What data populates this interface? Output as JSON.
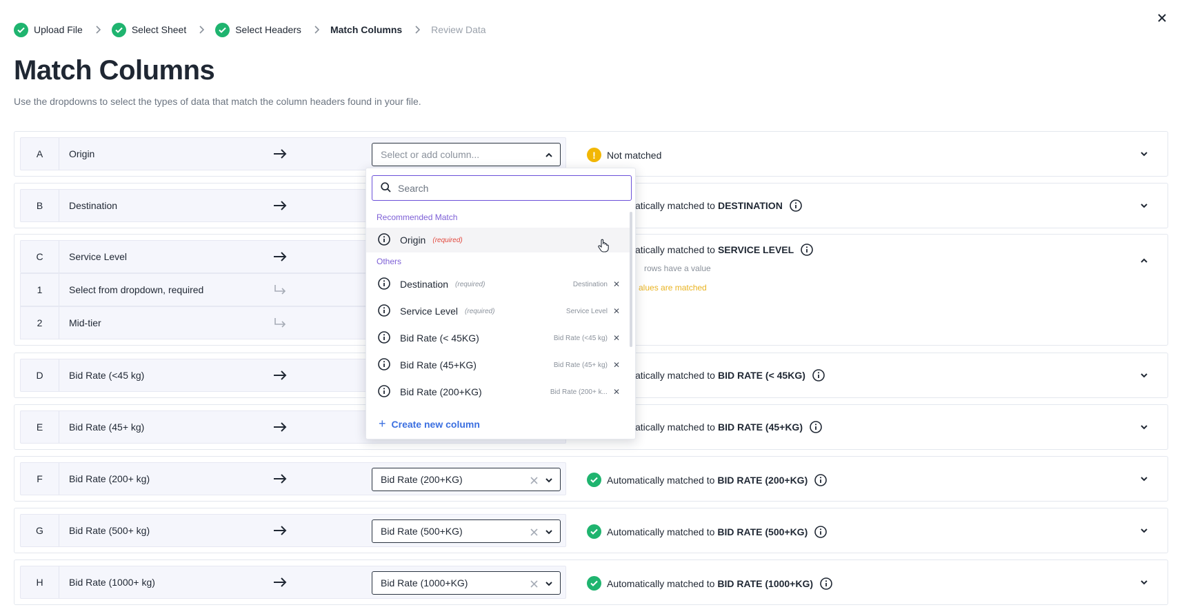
{
  "stepper": {
    "steps": [
      {
        "label": "Upload File",
        "state": "done"
      },
      {
        "label": "Select Sheet",
        "state": "done"
      },
      {
        "label": "Select Headers",
        "state": "done"
      },
      {
        "label": "Match Columns",
        "state": "active"
      },
      {
        "label": "Review Data",
        "state": "upcoming"
      }
    ]
  },
  "page": {
    "title": "Match Columns",
    "subtitle": "Use the dropdowns to select the types of data that match the column headers found in your file."
  },
  "rows": [
    {
      "letter": "A",
      "name": "Origin",
      "select_placeholder": "Select or add column...",
      "status_text": "Not matched"
    },
    {
      "letter": "B",
      "name": "Destination",
      "status_prefix": "atically matched to",
      "status_target": "DESTINATION"
    },
    {
      "letter": "C",
      "name": "Service Level",
      "status_prefix": "atically matched to",
      "status_target": "SERVICE LEVEL",
      "sub_rows": [
        {
          "index": "1",
          "value": "Select from dropdown, required"
        },
        {
          "index": "2",
          "value": "Mid-tier"
        }
      ],
      "detail_rows": "rows have a value",
      "detail_values": "alues are matched"
    },
    {
      "letter": "D",
      "name": "Bid Rate (<45 kg)",
      "status_prefix": "atically matched to",
      "status_target": "BID RATE (< 45KG)"
    },
    {
      "letter": "E",
      "name": "Bid Rate (45+ kg)",
      "status_prefix": "atically matched to",
      "status_target": "BID RATE (45+KG)"
    },
    {
      "letter": "F",
      "name": "Bid Rate (200+ kg)",
      "select_value": "Bid Rate (200+KG)",
      "status_prefix": "Automatically matched to",
      "status_target": "BID RATE (200+KG)"
    },
    {
      "letter": "G",
      "name": "Bid Rate (500+ kg)",
      "select_value": "Bid Rate (500+KG)",
      "status_prefix": "Automatically matched to",
      "status_target": "BID RATE (500+KG)"
    },
    {
      "letter": "H",
      "name": "Bid Rate (1000+ kg)",
      "select_value": "Bid Rate (1000+KG)",
      "status_prefix": "Automatically matched to",
      "status_target": "BID RATE (1000+KG)"
    }
  ],
  "dropdown": {
    "search_placeholder": "Search",
    "recommended_label": "Recommended Match",
    "others_label": "Others",
    "required_text": "(required)",
    "recommended": [
      {
        "label": "Origin"
      }
    ],
    "others": [
      {
        "label": "Destination",
        "required": true,
        "tag": "Destination"
      },
      {
        "label": "Service Level",
        "required": true,
        "tag": "Service Level"
      },
      {
        "label": "Bid Rate (< 45KG)",
        "tag": "Bid Rate (<45 kg)"
      },
      {
        "label": "Bid Rate (45+KG)",
        "tag": "Bid Rate (45+ kg)"
      },
      {
        "label": "Bid Rate (200+KG)",
        "tag": "Bid Rate (200+ k..."
      }
    ],
    "create_label": "Create new column"
  },
  "colors": {
    "success": "#1fb46f",
    "warning": "#f2b705",
    "accent_purple": "#7d5fd6",
    "link_blue": "#3b6fe0"
  }
}
